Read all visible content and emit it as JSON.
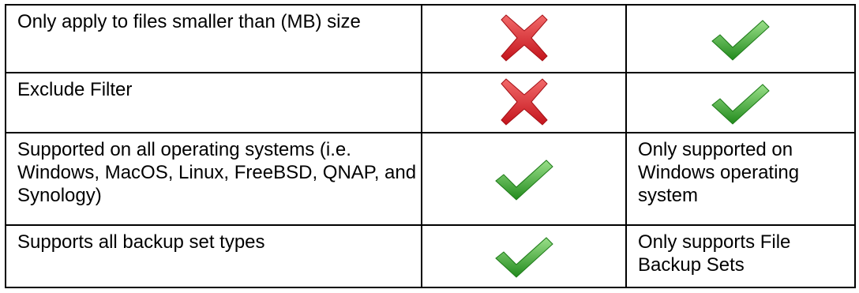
{
  "table": {
    "rows": [
      {
        "feature": "Only apply to files smaller than (MB) size",
        "col2": {
          "icon": "cross-icon"
        },
        "col3": {
          "icon": "check-icon"
        }
      },
      {
        "feature": "Exclude Filter",
        "col2": {
          "icon": "cross-icon"
        },
        "col3": {
          "icon": "check-icon"
        }
      },
      {
        "feature": "Supported on all operating systems (i.e. Windows, MacOS, Linux, FreeBSD, QNAP, and Synology)",
        "col2": {
          "icon": "check-icon"
        },
        "col3": {
          "text": "Only supported on Windows operating system"
        }
      },
      {
        "feature": "Supports all backup set types",
        "col2": {
          "icon": "check-icon"
        },
        "col3": {
          "text": "Only supports File Backup Sets"
        }
      }
    ]
  },
  "colors": {
    "cross": "#d9232a",
    "check": "#3a9a2a",
    "border": "#000000"
  }
}
